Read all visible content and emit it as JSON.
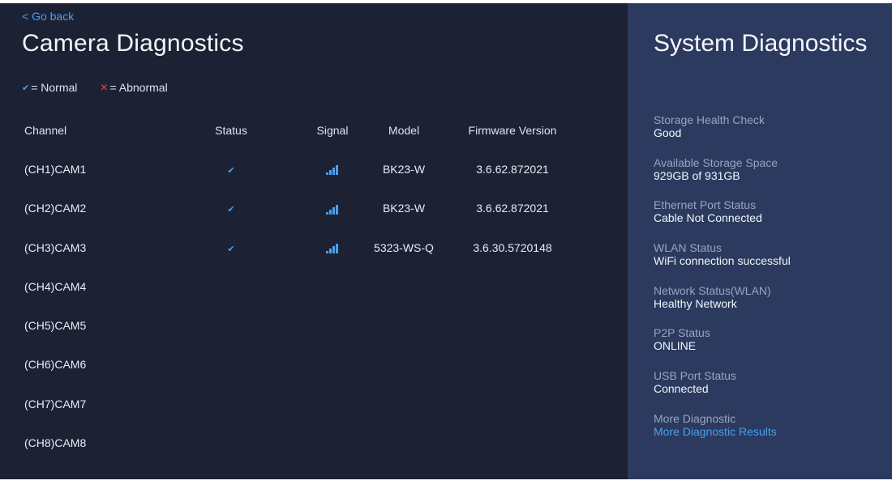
{
  "nav": {
    "go_back": "< Go back"
  },
  "camera": {
    "title": "Camera Diagnostics",
    "legend": {
      "normal": "= Normal",
      "abnormal": "= Abnormal"
    },
    "columns": {
      "channel": "Channel",
      "status": "Status",
      "signal": "Signal",
      "model": "Model",
      "firmware": "Firmware Version"
    },
    "rows": [
      {
        "channel": "(CH1)CAM1",
        "status": "normal",
        "signal": "full",
        "model": "BK23-W",
        "firmware": "3.6.62.872021"
      },
      {
        "channel": "(CH2)CAM2",
        "status": "normal",
        "signal": "full",
        "model": "BK23-W",
        "firmware": "3.6.62.872021"
      },
      {
        "channel": "(CH3)CAM3",
        "status": "normal",
        "signal": "full",
        "model": "5323-WS-Q",
        "firmware": "3.6.30.5720148"
      },
      {
        "channel": "(CH4)CAM4",
        "status": "",
        "signal": "",
        "model": "",
        "firmware": ""
      },
      {
        "channel": "(CH5)CAM5",
        "status": "",
        "signal": "",
        "model": "",
        "firmware": ""
      },
      {
        "channel": "(CH6)CAM6",
        "status": "",
        "signal": "",
        "model": "",
        "firmware": ""
      },
      {
        "channel": "(CH7)CAM7",
        "status": "",
        "signal": "",
        "model": "",
        "firmware": ""
      },
      {
        "channel": "(CH8)CAM8",
        "status": "",
        "signal": "",
        "model": "",
        "firmware": ""
      }
    ]
  },
  "system": {
    "title": "System Diagnostics",
    "items": [
      {
        "label": "Storage Health Check",
        "value": "Good"
      },
      {
        "label": "Available Storage Space",
        "value": "929GB of 931GB"
      },
      {
        "label": "Ethernet Port Status",
        "value": "Cable Not Connected"
      },
      {
        "label": "WLAN Status",
        "value": "WiFi connection successful"
      },
      {
        "label": "Network Status(WLAN)",
        "value": "Healthy Network"
      },
      {
        "label": "P2P Status",
        "value": "ONLINE"
      },
      {
        "label": "USB Port Status",
        "value": "Connected"
      },
      {
        "label": "More Diagnostic",
        "value": "More Diagnostic Results",
        "link": true
      }
    ]
  },
  "colors": {
    "left_bg": "#1c2233",
    "right_bg": "#2b3a5e",
    "accent": "#4a9ff0",
    "abnormal": "#e0424a"
  },
  "icons": {
    "status_normal": "check-icon",
    "status_abnormal": "cross-icon",
    "signal": "signal-bars-icon"
  }
}
